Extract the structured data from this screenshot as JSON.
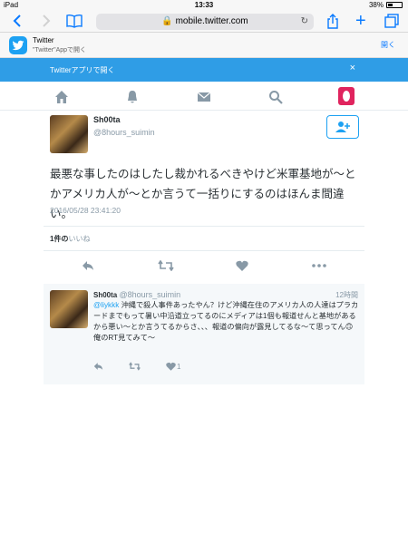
{
  "statusbar": {
    "device": "iPad",
    "time": "13:33",
    "battery": "38%"
  },
  "browser": {
    "url": "mobile.twitter.com",
    "back": "<",
    "forward": ">",
    "plus": "+"
  },
  "app_banner": {
    "app_name": "Twitter",
    "subtitle": "\"Twitter\"Appで開く",
    "open_label": "開く"
  },
  "blue_banner": {
    "text": "Twitterアプリで開く",
    "close": "×"
  },
  "tweet": {
    "name": "Sh00ta",
    "handle": "@8hours_suimin",
    "text": "最悪な事したのはしたし裁かれるべきやけど米軍基地が〜とかアメリカ人が〜とか言うて一括りにするのはほんま間違い。",
    "date": "2016/05/28 23:41:20",
    "likes_count": "1件の",
    "likes_label": "いいね"
  },
  "reply": {
    "name": "Sh00ta",
    "handle": "@8hours_suimin",
    "time": "12時間",
    "mention": "@liykkk",
    "text": " 沖縄で殺人事件あったやん？けど沖縄在住のアメリカ人の人達はプラカードまでもって暑い中沿道立ってるのにメディアは1個も報道せんと基地があるから悪い〜とか言うてるからさ、、、報道の偏向が露見してるな〜て思ってん🙃",
    "text2": "俺のRT見てみて〜",
    "like_count": "1"
  }
}
